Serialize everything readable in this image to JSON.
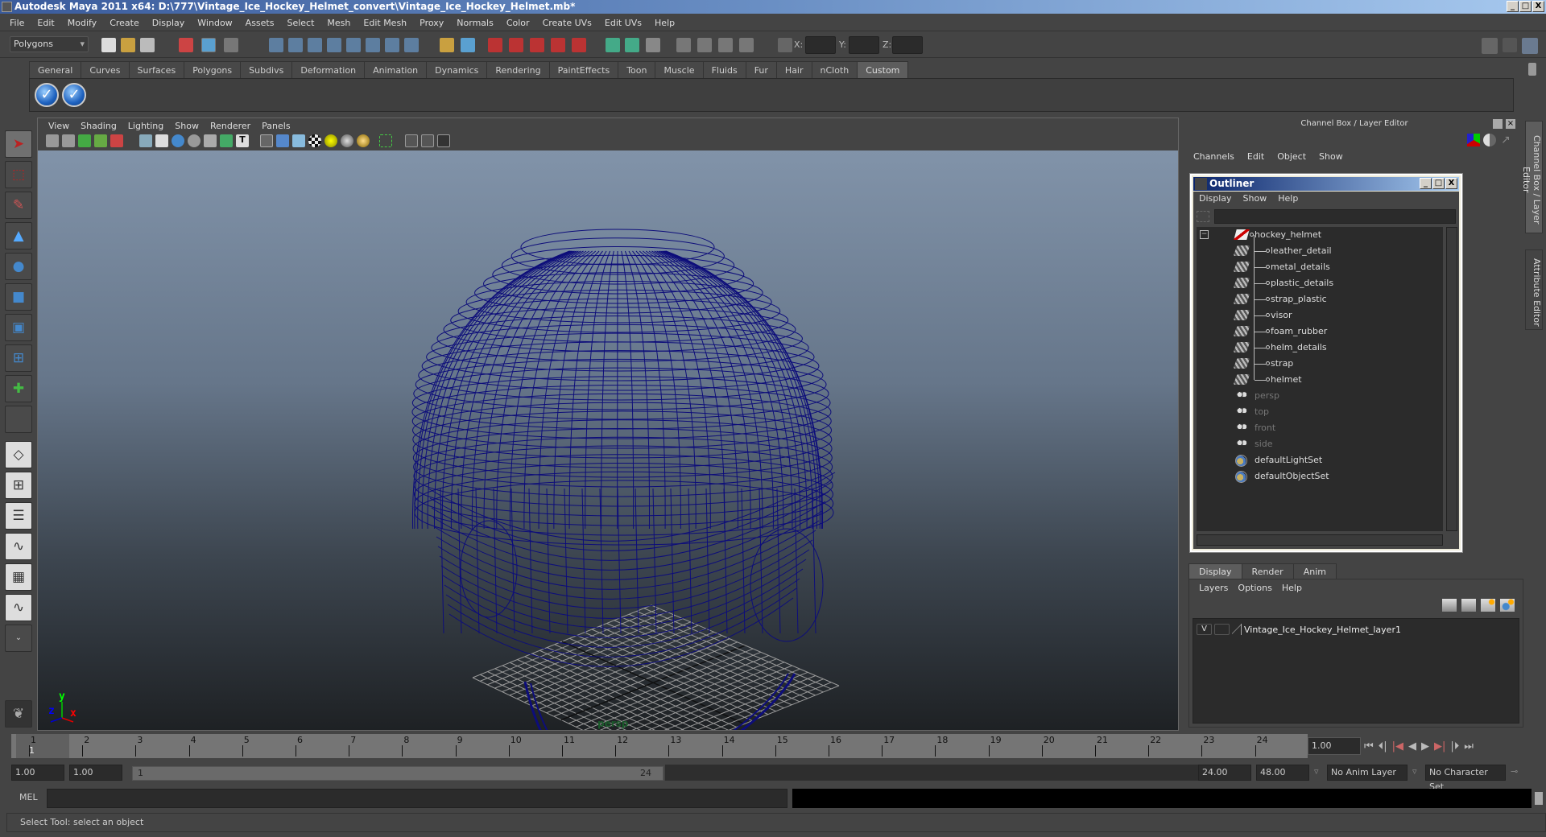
{
  "window": {
    "title": "Autodesk Maya 2011 x64: D:\\777\\Vintage_Ice_Hockey_Helmet_convert\\Vintage_Ice_Hockey_Helmet.mb*",
    "controls": [
      "_",
      "□",
      "X"
    ]
  },
  "menubar": [
    "File",
    "Edit",
    "Modify",
    "Create",
    "Display",
    "Window",
    "Assets",
    "Select",
    "Mesh",
    "Edit Mesh",
    "Proxy",
    "Normals",
    "Color",
    "Create UVs",
    "Edit UVs",
    "Help"
  ],
  "statusline": {
    "mode": "Polygons",
    "x_label": "X:",
    "y_label": "Y:",
    "z_label": "Z:",
    "x_value": "",
    "y_value": "",
    "z_value": ""
  },
  "shelf": {
    "tabs": [
      "General",
      "Curves",
      "Surfaces",
      "Polygons",
      "Subdivs",
      "Deformation",
      "Animation",
      "Dynamics",
      "Rendering",
      "PaintEffects",
      "Toon",
      "Muscle",
      "Fluids",
      "Fur",
      "Hair",
      "nCloth",
      "Custom"
    ],
    "active_tab": "Custom",
    "buttons": [
      "checkmark-button-1",
      "checkmark-button-2"
    ]
  },
  "toolbox": [
    "select-tool",
    "lasso-tool",
    "paint-select-tool",
    "move-tool",
    "rotate-tool",
    "scale-tool",
    "universal-manipulator",
    "soft-mod-tool",
    "show-manipulator",
    "last-tool"
  ],
  "viewport": {
    "menu": [
      "View",
      "Shading",
      "Lighting",
      "Show",
      "Renderer",
      "Panels"
    ],
    "camera_label": "persp",
    "axis": {
      "x": "x",
      "y": "y",
      "z": "z"
    },
    "wire_color": "#0d0d7a"
  },
  "channel_box": {
    "title": "Channel Box / Layer Editor",
    "menu": [
      "Channels",
      "Edit",
      "Object",
      "Show"
    ]
  },
  "outliner": {
    "title": "Outliner",
    "menu": [
      "Display",
      "Show",
      "Help"
    ],
    "filter_value": "",
    "items": [
      {
        "name": "hockey_helmet",
        "type": "group",
        "level": 0,
        "dim": false
      },
      {
        "name": "leather_detail",
        "type": "mesh",
        "level": 1,
        "dim": false
      },
      {
        "name": "metal_details",
        "type": "mesh",
        "level": 1,
        "dim": false
      },
      {
        "name": "plastic_details",
        "type": "mesh",
        "level": 1,
        "dim": false
      },
      {
        "name": "strap_plastic",
        "type": "mesh",
        "level": 1,
        "dim": false
      },
      {
        "name": "visor",
        "type": "mesh",
        "level": 1,
        "dim": false
      },
      {
        "name": "foam_rubber",
        "type": "mesh",
        "level": 1,
        "dim": false
      },
      {
        "name": "helm_details",
        "type": "mesh",
        "level": 1,
        "dim": false
      },
      {
        "name": "strap",
        "type": "mesh",
        "level": 1,
        "dim": false
      },
      {
        "name": "helmet",
        "type": "mesh",
        "level": 1,
        "dim": false
      },
      {
        "name": "persp",
        "type": "camera",
        "level": 0,
        "dim": true
      },
      {
        "name": "top",
        "type": "camera",
        "level": 0,
        "dim": true
      },
      {
        "name": "front",
        "type": "camera",
        "level": 0,
        "dim": true
      },
      {
        "name": "side",
        "type": "camera",
        "level": 0,
        "dim": true
      },
      {
        "name": "defaultLightSet",
        "type": "set",
        "level": 0,
        "dim": false
      },
      {
        "name": "defaultObjectSet",
        "type": "set",
        "level": 0,
        "dim": false
      }
    ]
  },
  "side_tabs": [
    "Channel Box / Layer Editor",
    "Attribute Editor"
  ],
  "layer_editor": {
    "tabs": [
      "Display",
      "Render",
      "Anim"
    ],
    "active_tab": "Display",
    "menu": [
      "Layers",
      "Options",
      "Help"
    ],
    "layers": [
      {
        "visible": "V",
        "name": "Vintage_Ice_Hockey_Helmet_layer1"
      }
    ]
  },
  "timeline": {
    "ticks": [
      "1",
      "2",
      "3",
      "4",
      "5",
      "6",
      "7",
      "8",
      "9",
      "10",
      "11",
      "12",
      "13",
      "14",
      "15",
      "16",
      "17",
      "18",
      "19",
      "20",
      "21",
      "22",
      "23",
      "24"
    ],
    "current_marker": "1",
    "current_frame": "1.00"
  },
  "range": {
    "start_time": "1.00",
    "playback_start": "1.00",
    "slider_start": "1",
    "slider_end": "24",
    "playback_end": "24.00",
    "end_time": "48.00",
    "anim_layer": "No Anim Layer",
    "character_set": "No Character Set"
  },
  "command_line": {
    "label": "MEL",
    "value": ""
  },
  "status_message": "Select Tool: select an object"
}
